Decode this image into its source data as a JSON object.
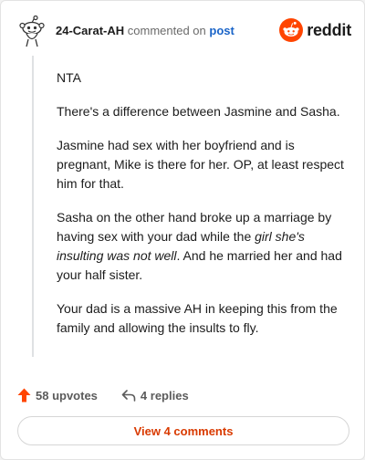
{
  "comment": {
    "username": "24-Carat-AH",
    "action_text": "commented on",
    "post_link": "post",
    "paragraphs": [
      {
        "segments": [
          {
            "text": "NTA",
            "italic": false
          }
        ]
      },
      {
        "segments": [
          {
            "text": "There's a difference between Jasmine and Sasha.",
            "italic": false
          }
        ]
      },
      {
        "segments": [
          {
            "text": "Jasmine had sex with her boyfriend and is pregnant, Mike is there for her. OP, at least respect him for that.",
            "italic": false
          }
        ]
      },
      {
        "segments": [
          {
            "text": "Sasha on the other hand broke up a marriage by having sex with your dad while the ",
            "italic": false
          },
          {
            "text": "girl she's insulting was not well",
            "italic": true
          },
          {
            "text": ". And he married her and had your half sister.",
            "italic": false
          }
        ]
      },
      {
        "segments": [
          {
            "text": "Your dad is a massive AH in keeping this from the family and allowing the insults to fly.",
            "italic": false
          }
        ]
      }
    ]
  },
  "brand": {
    "name": "reddit",
    "color": "#ff4500"
  },
  "footer": {
    "upvotes_label": "58 upvotes",
    "replies_label": "4 replies",
    "upvote_color": "#ff4500"
  },
  "view_button": {
    "label": "View 4 comments",
    "color": "#d93a00"
  }
}
